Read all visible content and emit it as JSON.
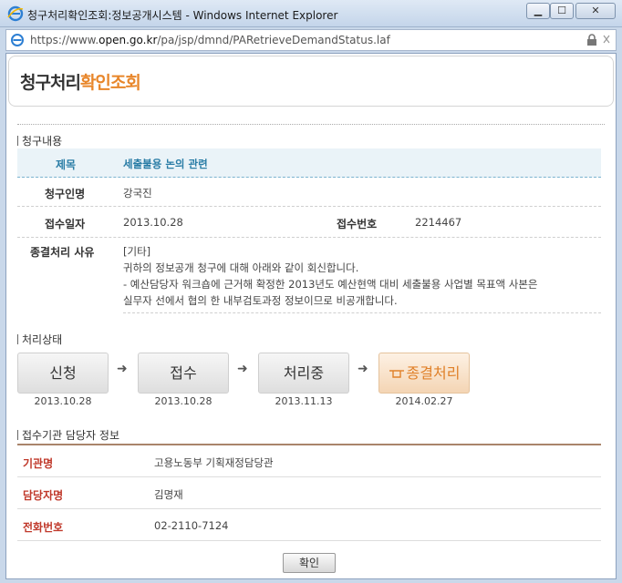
{
  "window": {
    "title": "청구처리확인조회:정보공개시스템 - Windows Internet Explorer",
    "url_prefix": "https://www.",
    "url_host": "open.go.kr",
    "url_path": "/pa/jsp/dmnd/PARetrieveDemandStatus.laf",
    "min_label": "▁",
    "max_label": "☐",
    "close_label": "✕"
  },
  "page": {
    "title_main": "청구처리",
    "title_accent": "확인조회"
  },
  "request": {
    "section_title": "청구내용",
    "subject_label": "제목",
    "subject_value": "세출불용 논의 관련",
    "requester_label": "청구인명",
    "requester_value": "강국진",
    "received_date_label": "접수일자",
    "received_date_value": "2013.10.28",
    "receipt_no_label": "접수번호",
    "receipt_no_value": "2214467",
    "reason_label": "종결처리 사유",
    "reason_lines": [
      "[기타]",
      "귀하의 정보공개 청구에 대해 아래와 같이 회신합니다.",
      "- 예산담당자 워크숍에 근거해 확정한 2013년도 예산현액 대비 세출불용 사업별 목표액 사본은",
      "실무자 선에서 협의 한 내부검토과정 정보이므로 비공개합니다."
    ]
  },
  "status": {
    "section_title": "처리상태",
    "steps": [
      {
        "label": "신청",
        "date": "2013.10.28"
      },
      {
        "label": "접수",
        "date": "2013.10.28"
      },
      {
        "label": "처리중",
        "date": "2013.11.13"
      },
      {
        "label": "종결처리",
        "date": "2014.02.27"
      }
    ],
    "arrow": "➜"
  },
  "contact": {
    "section_title": "접수기관 담당자 정보",
    "org_label": "기관명",
    "org_value": "고용노동부 기획재정담당관",
    "person_label": "담당자명",
    "person_value": "김명재",
    "phone_label": "전화번호",
    "phone_value": "02-2110-7124"
  },
  "confirm_label": "확인",
  "colors": {
    "accent": "#e8862a",
    "subject_text": "#2a7da6",
    "contact_label": "#c0392b"
  }
}
